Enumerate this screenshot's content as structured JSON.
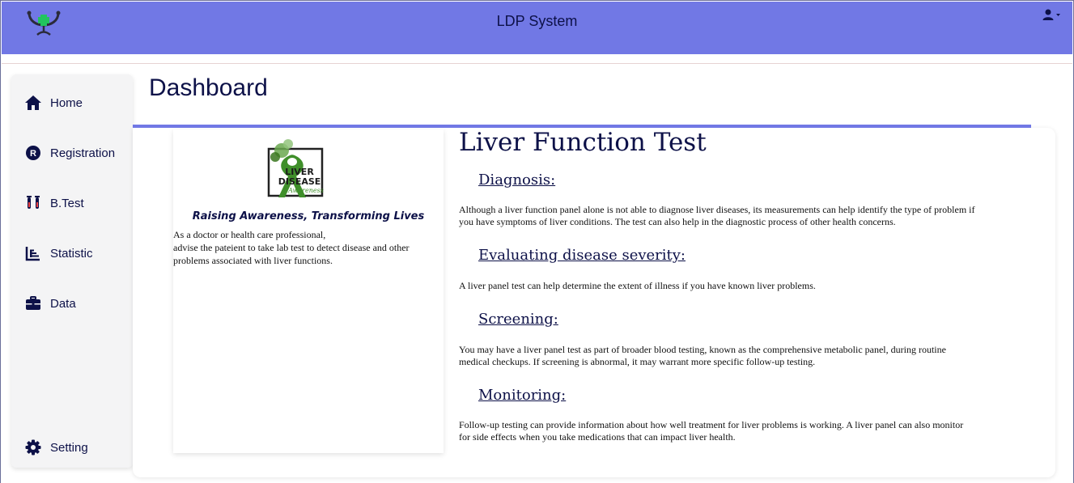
{
  "header": {
    "app_title": "LDP System",
    "logo_icon": "stethoscope-cross-logo",
    "user_icon": "user-icon",
    "caret_icon": "caret-down-icon",
    "bar_color": "#7178e5"
  },
  "sidebar": {
    "items": [
      {
        "label": "Home",
        "icon": "home-icon"
      },
      {
        "label": "Registration",
        "icon": "registered-icon"
      },
      {
        "label": "B.Test",
        "icon": "test-tubes-icon"
      },
      {
        "label": "Statistic",
        "icon": "bar-chart-icon"
      },
      {
        "label": "Data",
        "icon": "briefcase-icon"
      }
    ],
    "setting": {
      "label": "Setting",
      "icon": "gear-icon"
    }
  },
  "page": {
    "title": "Dashboard"
  },
  "left_card": {
    "image_text": [
      "LIVER",
      "DISEASE",
      "Awareness"
    ],
    "tagline": "Raising Awareness, Transforming Lives",
    "advice_line1": "As a doctor or health care professional,",
    "advice_line2": "advise the pateient to take lab test to detect disease and other problems associated with liver functions."
  },
  "article": {
    "title": "Liver Function Test",
    "sections": [
      {
        "heading": "Diagnosis:",
        "body": "Although a liver function panel alone is not able to diagnose liver diseases, its measurements can help identify the type of problem if you have symptoms of liver conditions. The test can also help in the diagnostic process of other health concerns."
      },
      {
        "heading": "Evaluating disease severity:",
        "body": "A liver panel test can help determine the extent of illness if you have known liver problems."
      },
      {
        "heading": "Screening:",
        "body": "You may have a liver panel test as part of broader blood testing, known as the comprehensive metabolic panel, during routine medical checkups. If screening is abnormal, it may warrant more specific follow-up testing."
      },
      {
        "heading": "Monitoring:",
        "body": "Follow-up testing can provide information about how well treatment for liver problems is working. A liver panel can also monitor for side effects when you take medications that can impact liver health."
      }
    ]
  },
  "colors": {
    "accent": "#7178e5",
    "text_dark": "#0d1148",
    "ribbon_green": "#3f8f2a"
  }
}
